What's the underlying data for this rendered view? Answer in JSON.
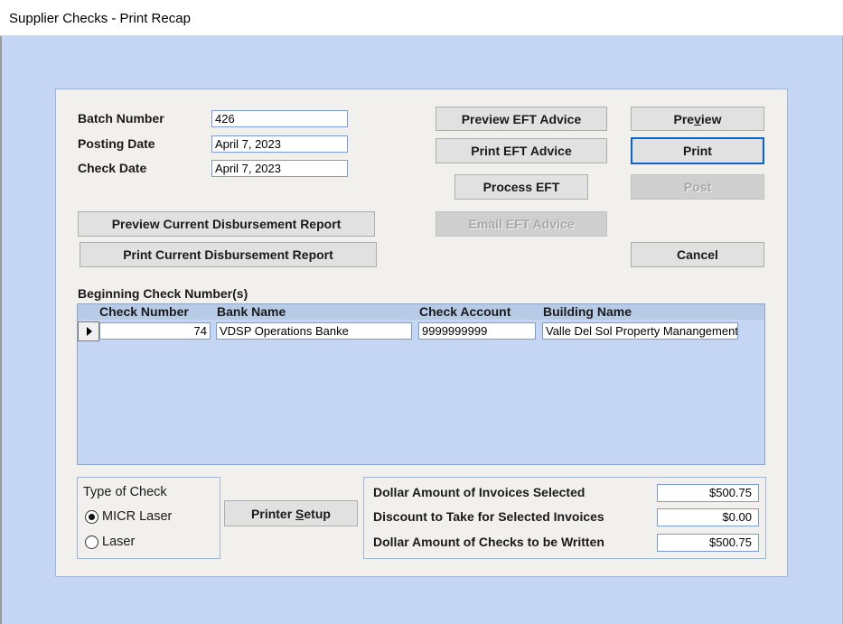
{
  "window": {
    "title": "Supplier Checks -  Print Recap"
  },
  "fields": {
    "batch_number_label": "Batch Number",
    "batch_number_value": "426",
    "posting_date_label": "Posting Date",
    "posting_date_value": "April 7, 2023",
    "check_date_label": "Check Date",
    "check_date_value": "April 7, 2023"
  },
  "buttons": {
    "preview_eft_advice": "Preview EFT Advice",
    "print_eft_advice": "Print EFT Advice",
    "process_eft": "Process EFT",
    "email_eft_advice": "Email EFT Advice",
    "preview_pre": "Pre",
    "preview_ul": "v",
    "preview_post": "iew",
    "print": "Print",
    "post": "Post",
    "cancel": "Cancel",
    "preview_disbursement": "Preview Current Disbursement Report",
    "print_disbursement": "Print Current Disbursement Report",
    "printer_setup_pre": "Printer ",
    "printer_setup_ul": "S",
    "printer_setup_post": "etup"
  },
  "grid": {
    "section_label": "Beginning Check Number(s)",
    "columns": [
      "Check Number",
      "Bank Name",
      "Check Account",
      "Building Name"
    ],
    "rows": [
      {
        "check_number": "74",
        "bank_name": "VDSP Operations Banke",
        "check_account": "9999999999",
        "building_name": "Valle Del Sol Property Manangement"
      }
    ]
  },
  "check_type": {
    "label": "Type of Check",
    "options": [
      {
        "label": "MICR Laser",
        "selected": true
      },
      {
        "label": "Laser",
        "selected": false
      }
    ]
  },
  "totals": {
    "invoices_selected_label": "Dollar Amount of Invoices Selected",
    "invoices_selected_value": "$500.75",
    "discount_label": "Discount to Take for Selected Invoices",
    "discount_value": "$0.00",
    "checks_written_label": "Dollar Amount of Checks to be Written",
    "checks_written_value": "$500.75"
  }
}
